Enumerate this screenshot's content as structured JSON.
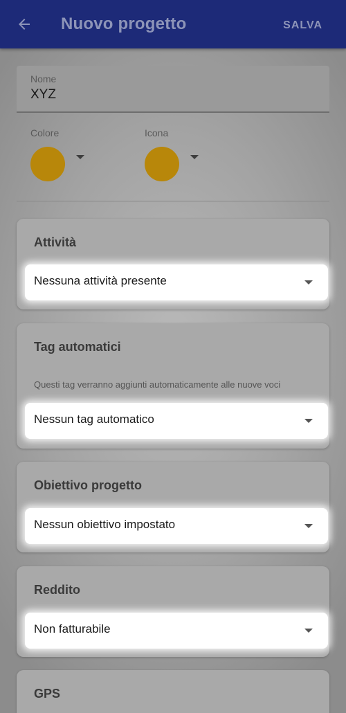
{
  "appbar": {
    "title": "Nuovo progetto",
    "save_label": "SALVA",
    "back_icon": "arrow-left-icon"
  },
  "form": {
    "name_label": "Nome",
    "name_value": "XYZ",
    "color_label": "Colore",
    "icon_label": "Icona",
    "swatch_color": "#b8870a"
  },
  "cards": {
    "activities": {
      "title": "Attività",
      "value": "Nessuna attività presente"
    },
    "auto_tags": {
      "title": "Tag automatici",
      "description": "Questi tag verranno aggiunti automaticamente alle nuove voci",
      "value": "Nessun tag automatico"
    },
    "goal": {
      "title": "Obiettivo progetto",
      "value": "Nessun obiettivo impostato"
    },
    "income": {
      "title": "Reddito",
      "value": "Non fatturabile"
    },
    "gps": {
      "title": "GPS"
    }
  },
  "colors": {
    "appbar": "#1d2a78",
    "accent_swatch": "#b8870a"
  }
}
